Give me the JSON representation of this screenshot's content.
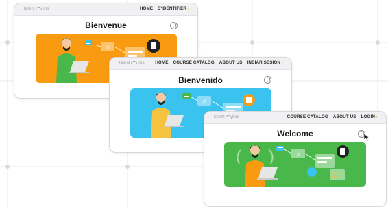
{
  "colors": {
    "orange": "#F89B10",
    "blue": "#3AC3EE",
    "green": "#49B749",
    "accent": "#F5A623"
  },
  "card_fr": {
    "logo": "talent",
    "logo_suffix": "lms",
    "menu": [
      "HOME",
      "S'IDENTIFIER"
    ],
    "title": "Bienvenue"
  },
  "card_es": {
    "logo": "talent",
    "logo_suffix": "lms",
    "menu": [
      "HOME",
      "COURSE CATALOG",
      "ABOUT US",
      "INCIAR SESIÓN"
    ],
    "title": "Bienvenido"
  },
  "card_en": {
    "logo": "talent",
    "logo_suffix": "lms",
    "menu": [
      "COURSE CATALOG",
      "ABOUT US",
      "LOGIN"
    ],
    "title": "Welcome"
  },
  "icons": {
    "globe": "globe-icon",
    "cursor": "cursor-icon",
    "dropdown": "chevron-right-icon"
  }
}
